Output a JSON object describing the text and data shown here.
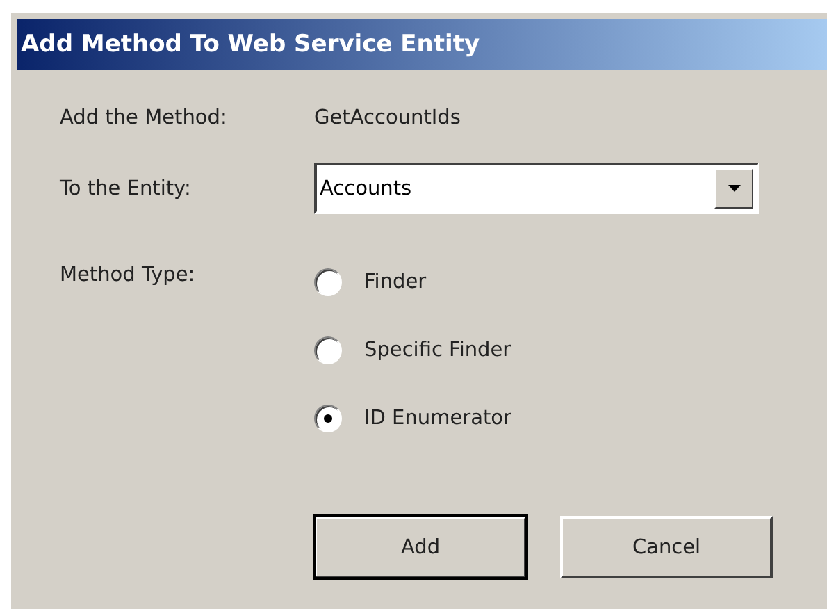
{
  "window": {
    "title": "Add Method To Web Service Entity"
  },
  "method": {
    "label": "Add the Method:",
    "value": "GetAccountIds"
  },
  "entity": {
    "label": "To the Entity:",
    "value": "Accounts"
  },
  "method_type": {
    "label": "Method Type:",
    "options": [
      {
        "label": "Finder",
        "selected": false
      },
      {
        "label": "Specific Finder",
        "selected": false
      },
      {
        "label": "ID Enumerator",
        "selected": true
      }
    ]
  },
  "buttons": [
    {
      "label": "Add",
      "default": true
    },
    {
      "label": "Cancel",
      "default": false
    }
  ]
}
